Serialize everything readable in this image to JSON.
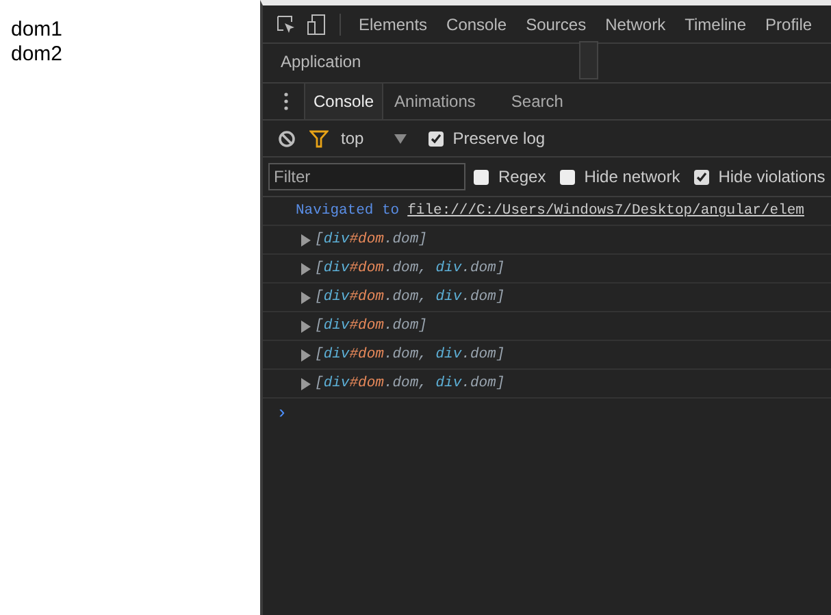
{
  "page": {
    "lines": [
      "dom1",
      "dom2"
    ]
  },
  "devtools": {
    "tabs": [
      {
        "label": "Elements",
        "selected": false
      },
      {
        "label": "Console",
        "selected": false
      },
      {
        "label": "Sources",
        "selected": false
      },
      {
        "label": "Network",
        "selected": false
      },
      {
        "label": "Timeline",
        "selected": false
      },
      {
        "label": "Profile",
        "selected": false
      },
      {
        "label": "Application",
        "selected": false
      }
    ],
    "drawer_tabs": [
      {
        "label": "Console",
        "selected": true
      },
      {
        "label": "Animations",
        "selected": false
      },
      {
        "label": "Search",
        "selected": false
      }
    ],
    "toolbar": {
      "context": "top",
      "preserve_log": {
        "label": "Preserve log",
        "checked": true
      }
    },
    "filter": {
      "placeholder": "Filter",
      "options": [
        {
          "label": "Regex",
          "checked": false
        },
        {
          "label": "Hide network",
          "checked": false
        },
        {
          "label": "Hide violations",
          "checked": true
        }
      ]
    },
    "console": {
      "navigated": {
        "label": "Navigated to",
        "url": "file:///C:/Users/Windows7/Desktop/angular/elem"
      },
      "entries": [
        "[div#dom.dom]",
        "[div#dom.dom, div.dom]",
        "[div#dom.dom, div.dom]",
        "[div#dom.dom]",
        "[div#dom.dom, div.dom]",
        "[div#dom.dom, div.dom]"
      ],
      "prompt": "›"
    }
  }
}
